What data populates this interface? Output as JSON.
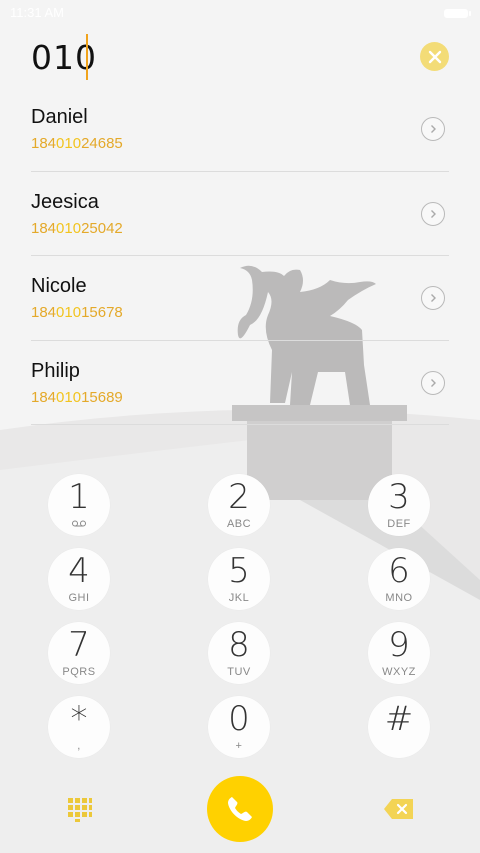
{
  "status_bar": {
    "time": "11:31 AM"
  },
  "dialer": {
    "input_value": "010"
  },
  "contacts": [
    {
      "name": "Daniel",
      "number_prefix": "184",
      "number_match": "010",
      "number_suffix": "24685"
    },
    {
      "name": "Jeesica",
      "number_prefix": "184",
      "number_match": "010",
      "number_suffix": "25042"
    },
    {
      "name": "Nicole",
      "number_prefix": "184",
      "number_match": "010",
      "number_suffix": "15678"
    },
    {
      "name": "Philip",
      "number_prefix": "184",
      "number_match": "010",
      "number_suffix": "15689"
    }
  ],
  "keypad": [
    {
      "digit": "1",
      "letters": "",
      "sub_icon": "voicemail-icon"
    },
    {
      "digit": "2",
      "letters": "ABC"
    },
    {
      "digit": "3",
      "letters": "DEF"
    },
    {
      "digit": "4",
      "letters": "GHI"
    },
    {
      "digit": "5",
      "letters": "JKL"
    },
    {
      "digit": "6",
      "letters": "MNO"
    },
    {
      "digit": "7",
      "letters": "PQRS"
    },
    {
      "digit": "8",
      "letters": "TUV"
    },
    {
      "digit": "9",
      "letters": "WXYZ"
    },
    {
      "digit": "*",
      "letters": ","
    },
    {
      "digit": "0",
      "letters": "+"
    },
    {
      "digit": "#",
      "letters": ""
    }
  ],
  "icons": {
    "clear": "close-icon",
    "detail": "chevron-right-icon",
    "dialpad": "dialpad-grid-icon",
    "call": "phone-icon",
    "backspace": "backspace-icon"
  },
  "colors": {
    "accent": "#ffd100",
    "number_text": "#e4a92a",
    "match_highlight": "#f2c41f",
    "clear_button": "#f3dc77"
  }
}
